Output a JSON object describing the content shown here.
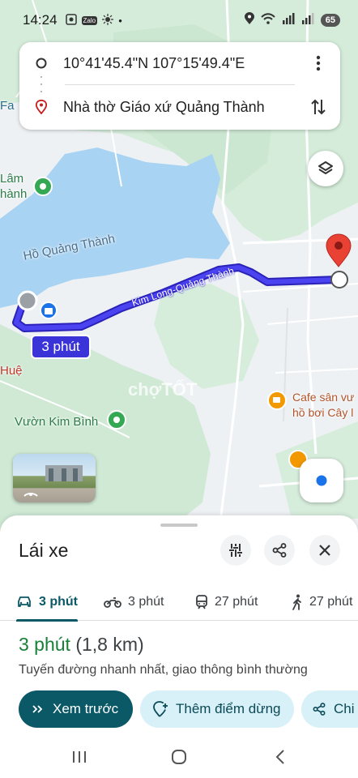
{
  "status_bar": {
    "time": "14:24",
    "zalo_label": "Zalo",
    "battery": "65"
  },
  "route_card": {
    "origin": "10°41'45.4\"N 107°15'49.4\"E",
    "destination": "Nhà thờ Giáo xứ Quảng Thành"
  },
  "map": {
    "labels": {
      "fa": "Fa",
      "lam": "Lâm",
      "thanh": "hành",
      "lake": "Hồ Quảng Thành",
      "road": "Kim Long-Quảng Thành",
      "hue": "Huệ",
      "vuon": "Vườn Kim Bình",
      "cafe_line1": "Cafe sân vư",
      "cafe_line2": "hồ bơi Cây l"
    },
    "route_time_badge": "3 phút",
    "watermark": "chợTỐT"
  },
  "sheet": {
    "title": "Lái xe",
    "modes": [
      {
        "label": "3 phút",
        "icon": "car-icon",
        "active": true
      },
      {
        "label": "3 phút",
        "icon": "motorbike-icon",
        "active": false
      },
      {
        "label": "27 phút",
        "icon": "transit-icon",
        "active": false
      },
      {
        "label": "27 phút",
        "icon": "walk-icon",
        "active": false
      }
    ],
    "summary_time": "3 phút",
    "summary_distance": "(1,8 km)",
    "summary_desc": "Tuyến đường nhanh nhất, giao thông bình thường",
    "buttons": {
      "preview": "Xem trước",
      "add_stop": "Thêm điểm dừng",
      "share": "Chi"
    }
  },
  "colors": {
    "route": "#3a2fd6",
    "accent": "#0b5866",
    "water": "#a9d3f2",
    "green": "#c9e8d0",
    "time_green": "#188038"
  }
}
